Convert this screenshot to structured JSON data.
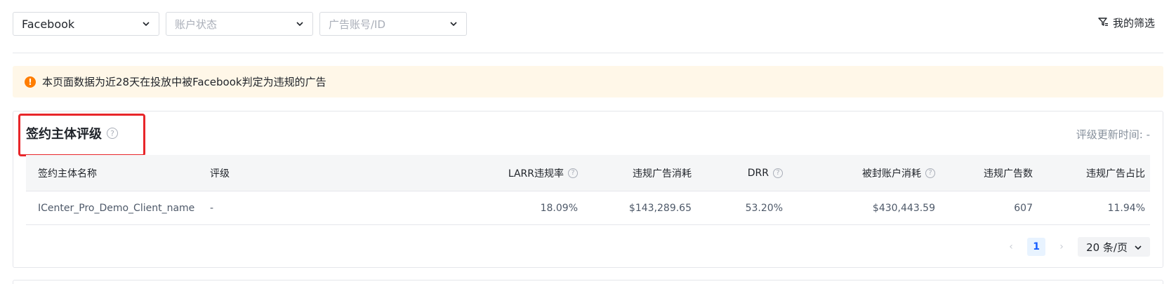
{
  "filters": {
    "platform": {
      "value": "Facebook"
    },
    "account_status": {
      "placeholder": "账户状态"
    },
    "ad_account": {
      "placeholder": "广告账号/ID"
    }
  },
  "my_filters_label": "我的筛选",
  "notice": {
    "icon": "!",
    "text": "本页面数据为近28天在投放中被Facebook判定为违规的广告",
    "color": "#fff7e8"
  },
  "card": {
    "title": "签约主体评级",
    "update_time_label": "评级更新时间: -",
    "highlight_color": "#e8262a"
  },
  "table": {
    "headers": {
      "name": "签约主体名称",
      "rating": "评级",
      "larr": "LARR违规率",
      "spend": "违规广告消耗",
      "drr": "DRR",
      "banned_spend": "被封账户消耗",
      "ad_count": "违规广告数",
      "ad_ratio": "违规广告占比"
    },
    "rows": [
      {
        "name": "ICenter_Pro_Demo_Client_name",
        "rating": "-",
        "larr": "18.09%",
        "spend": "$143,289.65",
        "drr": "53.20%",
        "banned_spend": "$430,443.59",
        "ad_count": "607",
        "ad_ratio": "11.94%"
      }
    ]
  },
  "pagination": {
    "prev": "‹",
    "current_page": "1",
    "next": "›",
    "page_size": "20 条/页",
    "accent": "#165dff"
  }
}
